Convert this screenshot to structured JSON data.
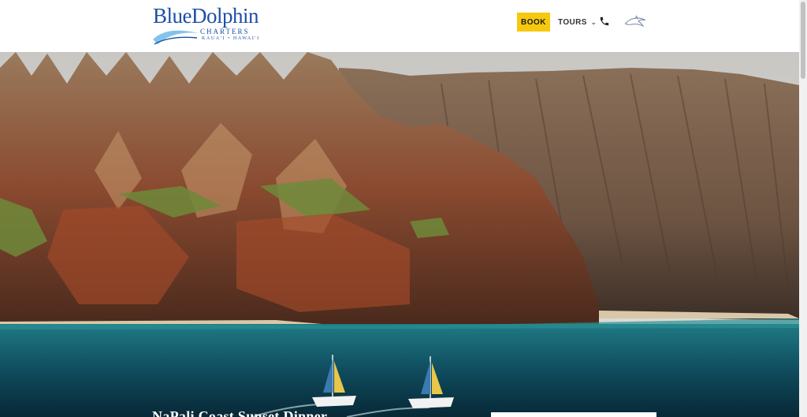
{
  "header": {
    "logo": {
      "name": "BlueDolphin",
      "subtitle": "CHARTERS",
      "location": "KAUA'I • HAWAI'I"
    },
    "nav": {
      "book_label": "BOOK",
      "tours_label": "TOURS"
    }
  },
  "icons": {
    "tours_dropdown": "chevron-down-icon",
    "phone": "phone-icon",
    "dolphin": "dolphin-icon"
  },
  "hero": {
    "title": "NaPali Coast Sunset Dinner"
  },
  "colors": {
    "accent_yellow": "#f6c90e",
    "brand_blue": "#1d4fa5"
  }
}
